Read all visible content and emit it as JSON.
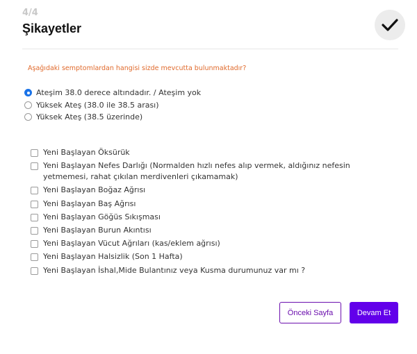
{
  "header": {
    "step": "4/4",
    "title": "Şikayetler",
    "confirm_icon": "checkmark-icon"
  },
  "question": "Aşağıdaki semptomlardan hangisi sizde mevcutta bulunmaktadır?",
  "fever_options": [
    {
      "label": "Ateşim 38.0 derece altındadır. / Ateşim yok",
      "selected": true
    },
    {
      "label": "Yüksek Ateş (38.0 ile 38.5 arası)",
      "selected": false
    },
    {
      "label": "Yüksek Ateş (38.5 üzerinde)",
      "selected": false
    }
  ],
  "symptoms": [
    {
      "label": "Yeni Başlayan Öksürük",
      "checked": false
    },
    {
      "label": "Yeni Başlayan Nefes Darlığı (Normalden hızlı nefes alıp vermek, aldığınız nefesin yetmemesi, rahat çıkılan merdivenleri çıkamamak)",
      "checked": false
    },
    {
      "label": "Yeni Başlayan Boğaz Ağrısı",
      "checked": false
    },
    {
      "label": "Yeni Başlayan Baş Ağrısı",
      "checked": false
    },
    {
      "label": "Yeni Başlayan Göğüs Sıkışması",
      "checked": false
    },
    {
      "label": "Yeni Başlayan Burun Akıntısı",
      "checked": false
    },
    {
      "label": "Yeni Başlayan Vücut Ağrıları (kas/eklem ağrısı)",
      "checked": false
    },
    {
      "label": "Yeni Başlayan Halsizlik (Son 1 Hafta)",
      "checked": false
    },
    {
      "label": "Yeni Başlayan İshal,Mide Bulantınız veya Kusma durumunuz var mı ?",
      "checked": false
    }
  ],
  "buttons": {
    "prev": "Önceki Sayfa",
    "next": "Devam Et"
  },
  "colors": {
    "accent": "#6200ea",
    "question": "#e06a2c",
    "radio_selected": "#1a73e8"
  }
}
